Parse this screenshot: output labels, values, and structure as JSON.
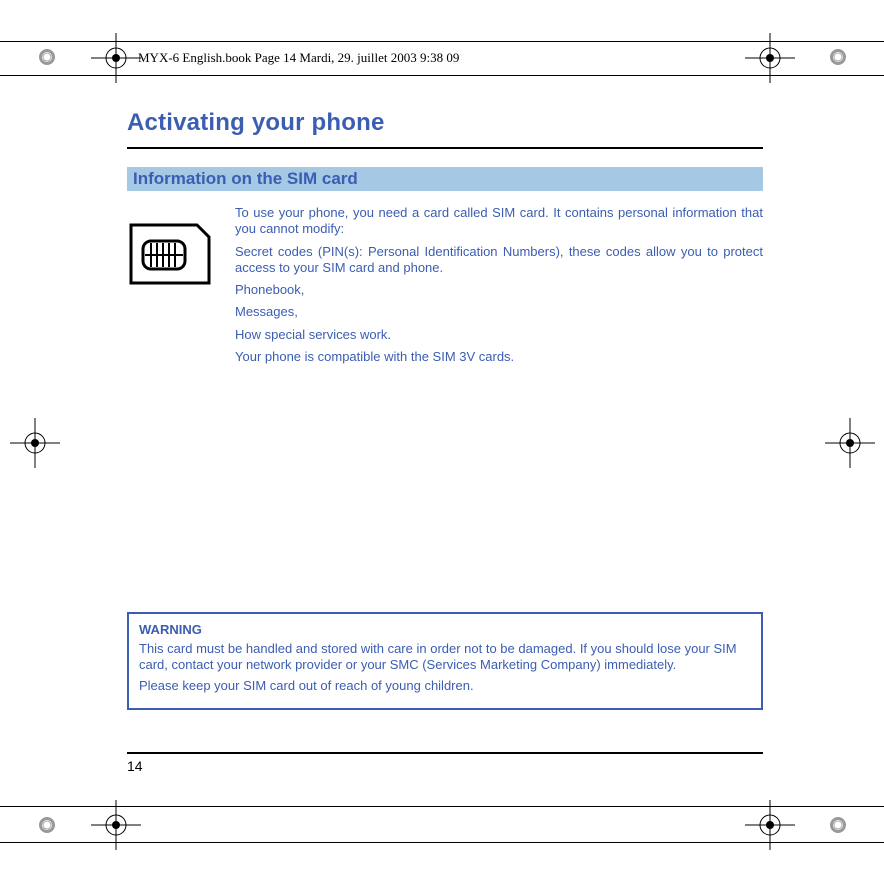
{
  "header": {
    "runhead": "MYX-6 English.book  Page 14  Mardi, 29. juillet 2003  9:38 09"
  },
  "page": {
    "title": "Activating your phone",
    "section_heading": "Information on the SIM card",
    "body": {
      "p1": "To use your phone, you need a card called SIM card. It contains personal information that you cannot modify:",
      "p2": "Secret codes (PIN(s): Personal Identification Numbers), these codes allow you to protect access to your SIM card and phone.",
      "p3": "Phonebook,",
      "p4": "Messages,",
      "p5": "How special services work.",
      "p6": "Your phone is compatible with the SIM 3V cards."
    },
    "warning": {
      "title": "WARNING",
      "p1": "This card must be handled and stored with care in order not to be damaged. If you should lose your SIM card, contact your network provider or your SMC (Services Marketing Company) immediately.",
      "p2": "Please keep your SIM card out of reach of young children."
    },
    "number": "14"
  }
}
